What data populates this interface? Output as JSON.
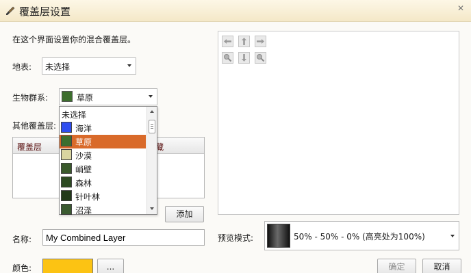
{
  "window": {
    "title": "覆盖层设置",
    "icon": "brush-icon",
    "close_icon": "close-icon"
  },
  "description": "在这个界面设置你的混合覆盖层。",
  "terrain": {
    "label": "地表:",
    "value": "未选择"
  },
  "biome": {
    "label": "生物群系:",
    "value": "草原",
    "swatch_color": "#3d6e2e"
  },
  "other_layers": {
    "label": "其他覆盖层:",
    "columns": [
      "覆盖层",
      "藏"
    ],
    "add_label": "添加"
  },
  "biome_dropdown": {
    "items": [
      {
        "label": "未选择",
        "color": null
      },
      {
        "label": "海洋",
        "color": "#2f4ef0"
      },
      {
        "label": "草原",
        "color": "#3d6e2e",
        "selected": true
      },
      {
        "label": "沙漠",
        "color": "#d9d5a0"
      },
      {
        "label": "峭壁",
        "color": "#3a5a2c"
      },
      {
        "label": "森林",
        "color": "#2d4a22"
      },
      {
        "label": "针叶林",
        "color": "#233a1a"
      },
      {
        "label": "沼泽",
        "color": "#3a5a30"
      }
    ]
  },
  "preview_nav": [
    {
      "name": "pan-left-icon"
    },
    {
      "name": "pan-up-icon"
    },
    {
      "name": "pan-right-icon"
    },
    {
      "name": "zoom-in-icon"
    },
    {
      "name": "pan-down-icon"
    },
    {
      "name": "zoom-out-icon"
    }
  ],
  "name_field": {
    "label": "名称:",
    "value": "My Combined Layer"
  },
  "preview_mode": {
    "label": "预览模式:",
    "value": "50% - 50% - 0% (高亮处为100%)"
  },
  "color": {
    "label": "颜色:",
    "value": "#fcc313",
    "picker_label": "..."
  },
  "buttons": {
    "ok": "确定",
    "cancel": "取消"
  }
}
